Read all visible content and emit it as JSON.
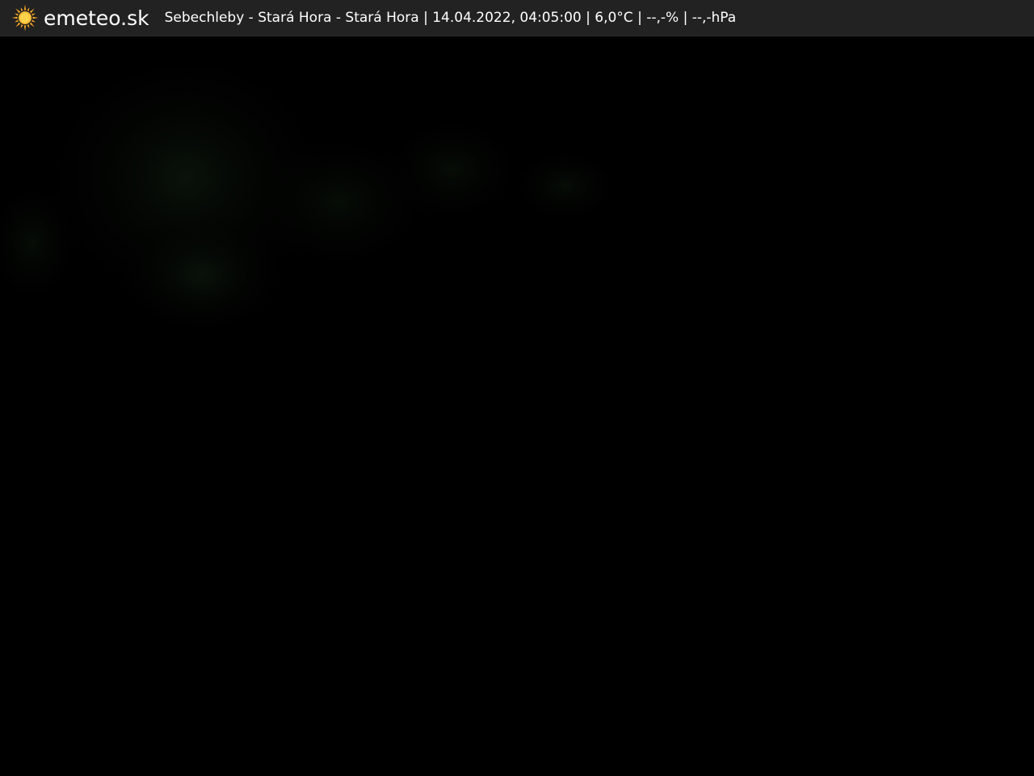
{
  "header": {
    "logo_icon": "sun-icon",
    "brand": "emeteo.sk",
    "caption": "Sebechleby - Stará Hora - Stará Hora | 14.04.2022, 04:05:00 | 6,0°C | --,-% | --,-hPa"
  },
  "colors": {
    "bar_background": "#222222",
    "frame_background": "#000000",
    "sun": "#f5a623",
    "text": "#ffffff"
  }
}
